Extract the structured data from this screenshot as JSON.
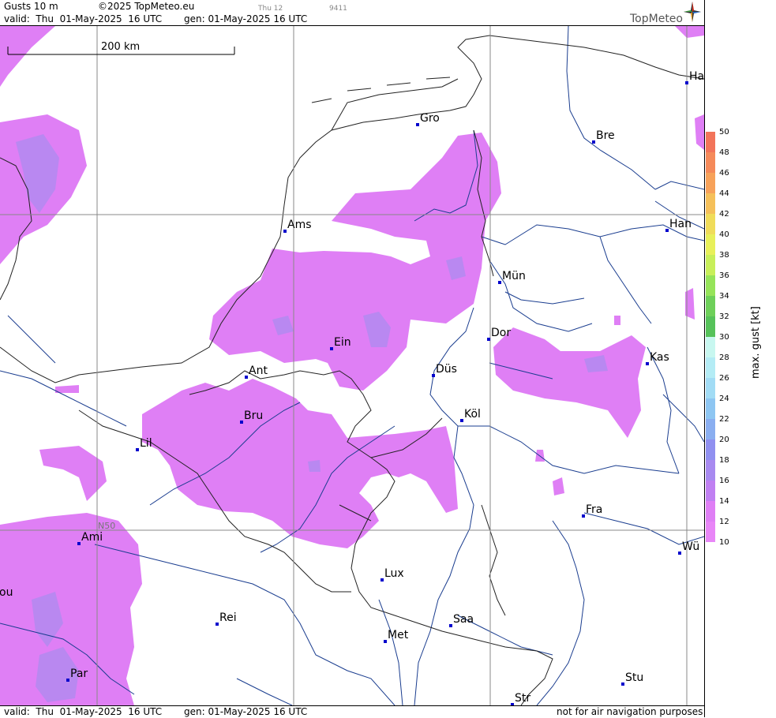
{
  "header": {
    "title": "Gusts 10 m",
    "copyright": "©2025 TopMeteo.eu",
    "day_code": "Thu 12",
    "code": "9411",
    "valid": "valid:  Thu  01-May-2025  16 UTC",
    "generated": "gen: 01-May-2025 16 UTC",
    "logo": "TopMeteo"
  },
  "footer": {
    "valid": "valid:  Thu  01-May-2025  16 UTC",
    "generated": "gen: 01-May-2025 16 UTC",
    "disclaimer": "not for air navigation purposes"
  },
  "map": {
    "scale_label": "200 km",
    "lat_label": "N50",
    "cities": [
      {
        "name": "Gro"
      },
      {
        "name": "Bre"
      },
      {
        "name": "Ha"
      },
      {
        "name": "Ams"
      },
      {
        "name": "Han"
      },
      {
        "name": "Mün"
      },
      {
        "name": "Dor"
      },
      {
        "name": "Ein"
      },
      {
        "name": "Kas"
      },
      {
        "name": "Ant"
      },
      {
        "name": "Düs"
      },
      {
        "name": "Köl"
      },
      {
        "name": "Bru"
      },
      {
        "name": "Lil"
      },
      {
        "name": "Fra"
      },
      {
        "name": "Ami"
      },
      {
        "name": "Wü"
      },
      {
        "name": "Lux"
      },
      {
        "name": "ou"
      },
      {
        "name": "Rei"
      },
      {
        "name": "Saa"
      },
      {
        "name": "Met"
      },
      {
        "name": "Stu"
      },
      {
        "name": "Par"
      },
      {
        "name": "Str"
      }
    ]
  },
  "legend": {
    "title": "max. gust [kt]",
    "ticks": [
      "50",
      "48",
      "46",
      "44",
      "42",
      "40",
      "38",
      "36",
      "34",
      "32",
      "30",
      "28",
      "26",
      "24",
      "22",
      "20",
      "18",
      "16",
      "14",
      "12",
      "10"
    ],
    "colors": [
      "#f2745a",
      "#f58a5a",
      "#f7a25a",
      "#f5c05a",
      "#f0dc5a",
      "#e8f05a",
      "#c8ef5a",
      "#96e45a",
      "#6ed05a",
      "#56c25a",
      "#c8f7f0",
      "#b4ecf5",
      "#a2dcf5",
      "#8ec6f2",
      "#8aaef0",
      "#9090f0",
      "#a88af0",
      "#c080f2",
      "#df7ff5",
      "#e886f7"
    ],
    "accent_gust": "#df7ff5",
    "accent_gust_strong": "#b38af0"
  }
}
